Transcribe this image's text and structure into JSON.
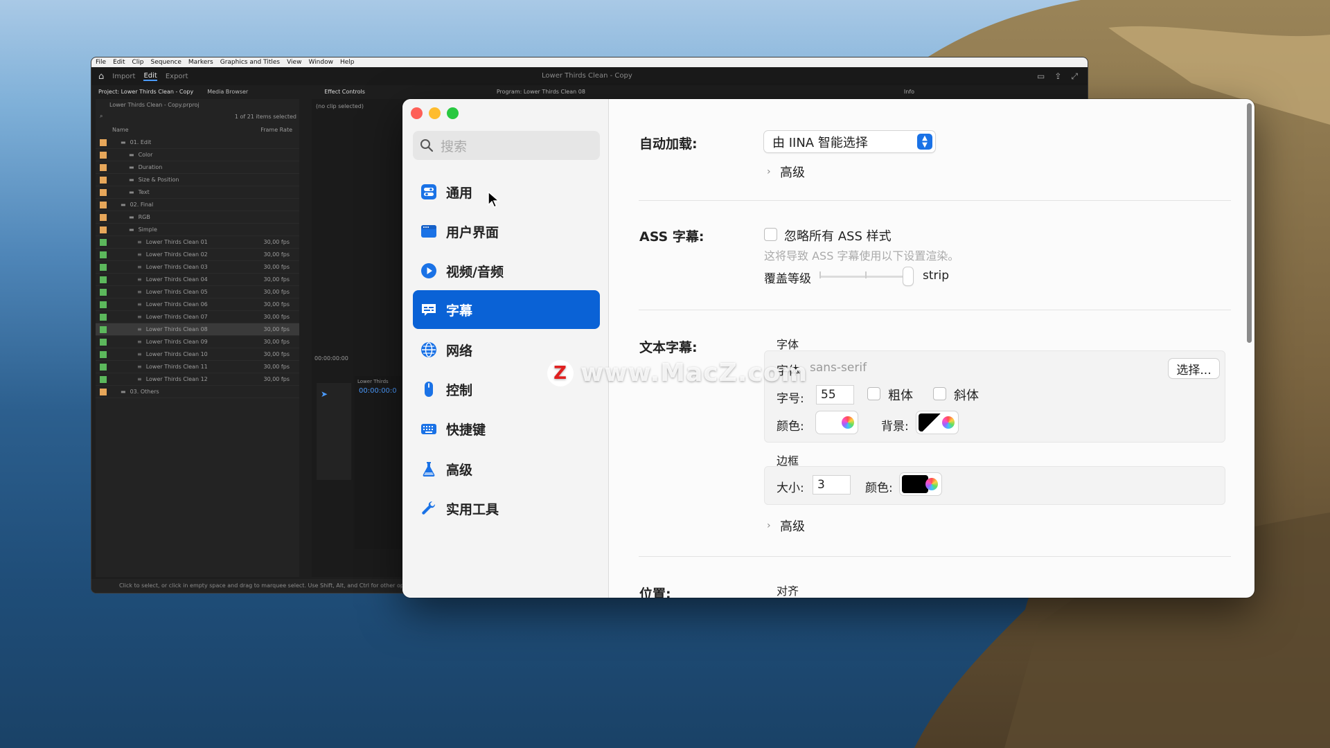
{
  "premiere": {
    "menu": [
      "File",
      "Edit",
      "Clip",
      "Sequence",
      "Markers",
      "Graphics and Titles",
      "View",
      "Window",
      "Help"
    ],
    "workspace_tabs": [
      "Import",
      "Edit",
      "Export"
    ],
    "title": "Lower Thirds Clean - Copy",
    "project_tab": "Project: Lower Thirds Clean - Copy",
    "media_browser_tab": "Media Browser",
    "effect_controls_tab": "Effect Controls",
    "program_tab": "Program: Lower Thirds Clean 08",
    "info_tab": "Info",
    "project_file": "Lower Thirds Clean - Copy.prproj",
    "selection_count": "1 of 21 items selected",
    "col_name": "Name",
    "col_frame_rate": "Frame Rate",
    "no_clip": "(no clip selected)",
    "timecode": "00:00:00:00",
    "timeline_timecode": "00:00:00:0",
    "timeline_tab": "Lower Thirds",
    "status_text": "Click to select, or click in empty space and drag to marquee select. Use Shift, Alt, and Ctrl for other options.",
    "rows": [
      {
        "name": "01. Edit",
        "fps": ""
      },
      {
        "name": "Color",
        "fps": ""
      },
      {
        "name": "Duration",
        "fps": ""
      },
      {
        "name": "Size & Position",
        "fps": ""
      },
      {
        "name": "Text",
        "fps": ""
      },
      {
        "name": "02. Final",
        "fps": ""
      },
      {
        "name": "RGB",
        "fps": ""
      },
      {
        "name": "Simple",
        "fps": ""
      },
      {
        "name": "Lower Thirds Clean 01",
        "fps": "30,00 fps"
      },
      {
        "name": "Lower Thirds Clean 02",
        "fps": "30,00 fps"
      },
      {
        "name": "Lower Thirds Clean 03",
        "fps": "30,00 fps"
      },
      {
        "name": "Lower Thirds Clean 04",
        "fps": "30,00 fps"
      },
      {
        "name": "Lower Thirds Clean 05",
        "fps": "30,00 fps"
      },
      {
        "name": "Lower Thirds Clean 06",
        "fps": "30,00 fps"
      },
      {
        "name": "Lower Thirds Clean 07",
        "fps": "30,00 fps"
      },
      {
        "name": "Lower Thirds Clean 08",
        "fps": "30,00 fps"
      },
      {
        "name": "Lower Thirds Clean 09",
        "fps": "30,00 fps"
      },
      {
        "name": "Lower Thirds Clean 10",
        "fps": "30,00 fps"
      },
      {
        "name": "Lower Thirds Clean 11",
        "fps": "30,00 fps"
      },
      {
        "name": "Lower Thirds Clean 12",
        "fps": "30,00 fps"
      },
      {
        "name": "03. Others",
        "fps": ""
      }
    ]
  },
  "prefs": {
    "search_placeholder": "搜索",
    "nav": [
      {
        "label": "通用",
        "icon": "toggle-icon"
      },
      {
        "label": "用户界面",
        "icon": "window-icon"
      },
      {
        "label": "视频/音频",
        "icon": "play-icon"
      },
      {
        "label": "字幕",
        "icon": "subtitle-icon"
      },
      {
        "label": "网络",
        "icon": "globe-icon"
      },
      {
        "label": "控制",
        "icon": "mouse-icon"
      },
      {
        "label": "快捷键",
        "icon": "keyboard-icon"
      },
      {
        "label": "高级",
        "icon": "flask-icon"
      },
      {
        "label": "实用工具",
        "icon": "wrench-icon"
      }
    ],
    "active_index": 3,
    "autoload_label": "自动加载:",
    "autoload_value": "由 IINA 智能选择",
    "advanced_label": "高级",
    "ass_label": "ASS 字幕:",
    "ass_ignore": "忽略所有 ASS 样式",
    "ass_hint": "这将导致 ASS 字幕使用以下设置渲染。",
    "override_level_label": "覆盖等级",
    "override_value": "strip",
    "text_sub_label": "文本字幕:",
    "font_group": "字体",
    "font_label": "字体",
    "font_value": "sans-serif",
    "choose_button": "选择...",
    "size_label": "字号:",
    "size_value": "55",
    "bold_label": "粗体",
    "italic_label": "斜体",
    "color_label": "颜色:",
    "bg_label": "背景:",
    "border_group": "边框",
    "border_size_label": "大小:",
    "border_size_value": "3",
    "border_color_label": "颜色:",
    "advanced2_label": "高级",
    "position_label": "位置:",
    "align_label": "对齐"
  },
  "watermark": {
    "logo": "Z",
    "text": "www.MacZ.com"
  },
  "colors": {
    "accent": "#0a62d6",
    "nav_icon": "#1a72e6"
  }
}
